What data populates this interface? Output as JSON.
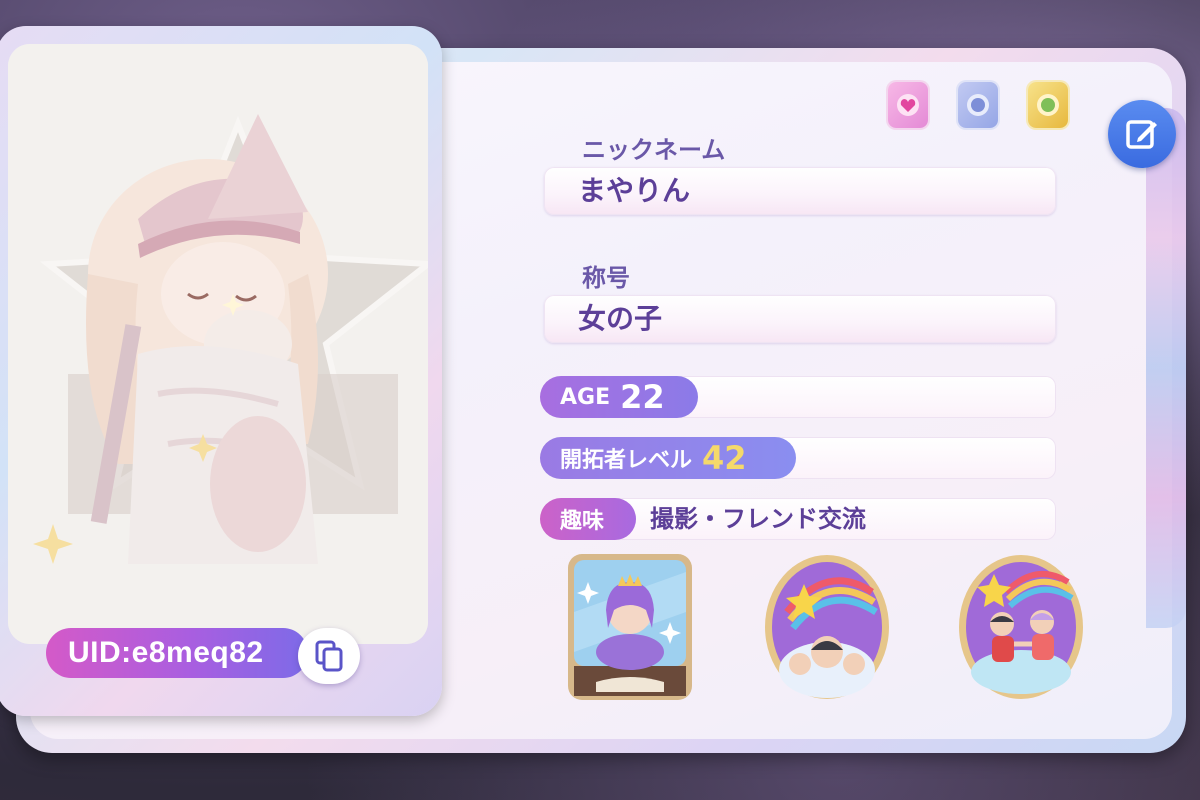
{
  "profile": {
    "nickname_label": "ニックネーム",
    "nickname": "まやりん",
    "title_label": "称号",
    "title": "女の子",
    "uid": "UID:e8meq82"
  },
  "stats": {
    "age_label": "AGE",
    "age": "22",
    "level_label": "開拓者レベル",
    "level": "42",
    "hobby_label": "趣味",
    "hobby": "撮影・フレンド交流"
  },
  "icons": {
    "copy": "copy-icon",
    "edit": "edit-icon",
    "card_pink": "heart-card-icon",
    "card_blue": "blue-card-icon",
    "card_gold": "gold-card-icon"
  },
  "colors": {
    "accent_purple": "#6a58a8",
    "uid_gradient_start": "#d45ac8",
    "uid_gradient_end": "#7d6be8",
    "level_number": "#f5d96a",
    "edit_button": "#3a6be0"
  }
}
